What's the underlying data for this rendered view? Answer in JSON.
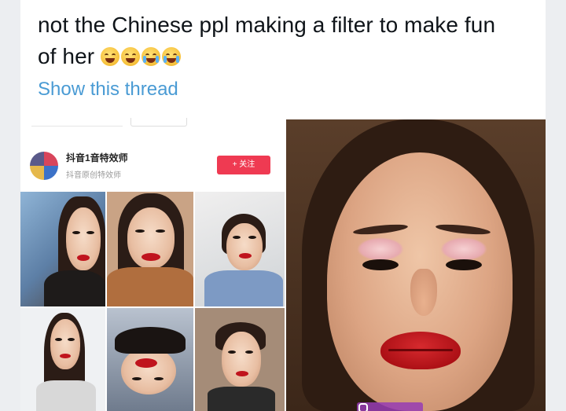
{
  "tweet": {
    "text": "not the Chinese ppl making a filter to make fun of her",
    "emojis": [
      "face-with-tears-of-joy",
      "face-with-tears-of-joy",
      "loudly-crying-face",
      "loudly-crying-face"
    ],
    "show_thread": "Show this thread"
  },
  "app_screenshot": {
    "profile_name": "抖音1音特效师",
    "profile_sub": "抖音原创特效师",
    "follow_label": "+ 关注"
  },
  "colors": {
    "link": "#4a9bd4",
    "text": "#0f1419",
    "follow_button": "#ef3a52"
  }
}
